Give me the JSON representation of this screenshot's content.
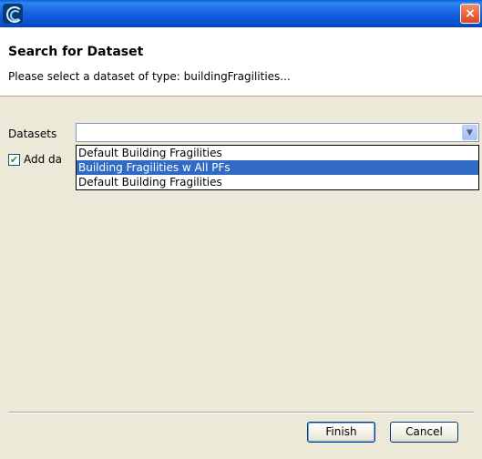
{
  "titlebar": {
    "app_icon": "app-logo-icon",
    "close_icon": "close-icon",
    "close_label": "×"
  },
  "header": {
    "title": "Search for Dataset",
    "description": "Please select a dataset of type: buildingFragilities..."
  },
  "form": {
    "datasets_label": "Datasets",
    "combo_value": "",
    "combo_arrow": "▼",
    "dropdown_options": [
      "Default Building Fragilities",
      "Building Fragilities w All PFs",
      "Default Building Fragilities"
    ],
    "selected_index": 1,
    "checkbox_checked": true,
    "checkbox_mark": "✔",
    "checkbox_label_visible": "Add da"
  },
  "buttons": {
    "finish": "Finish",
    "cancel": "Cancel"
  }
}
